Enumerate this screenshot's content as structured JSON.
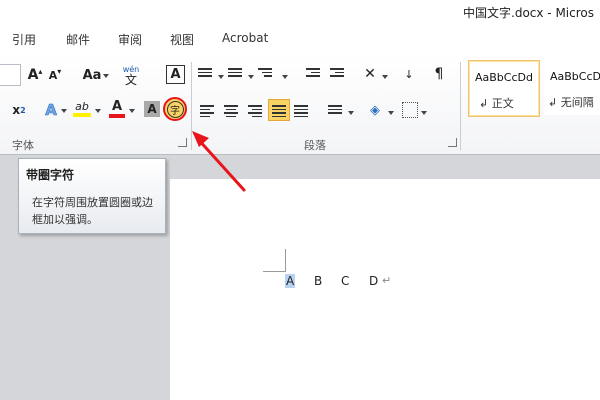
{
  "window": {
    "title": "中国文字.docx - Micros"
  },
  "tabs": [
    "引用",
    "邮件",
    "审阅",
    "视图",
    "Acrobat"
  ],
  "font_group": {
    "label": "字体",
    "buttons": {
      "grow_font": "A",
      "shrink_font": "A",
      "change_case": "Aa",
      "phonetic_guide": "wén",
      "phonetic_char": "文",
      "char_border": "A",
      "superscript": "x",
      "superscript_exp": "2",
      "text_effects": "A",
      "highlight": "ab",
      "font_color": "A",
      "char_shading": "A",
      "enclose_char": "字"
    }
  },
  "paragraph_group": {
    "label": "段落"
  },
  "styles": [
    {
      "sample": "AaBbCcDd",
      "name": "正文"
    },
    {
      "sample": "AaBbCcDc",
      "name": "无间隔"
    }
  ],
  "tooltip": {
    "title": "带圈字符",
    "body": "在字符周围放置圆圈或边框加以强调。"
  },
  "document": {
    "letters": [
      "A",
      "B",
      "C",
      "D"
    ],
    "paragraph_mark": "↵"
  },
  "colors": {
    "highlight_red": "#e8141b",
    "selection": "#b8d3f0",
    "active_button": "#fbd364"
  }
}
